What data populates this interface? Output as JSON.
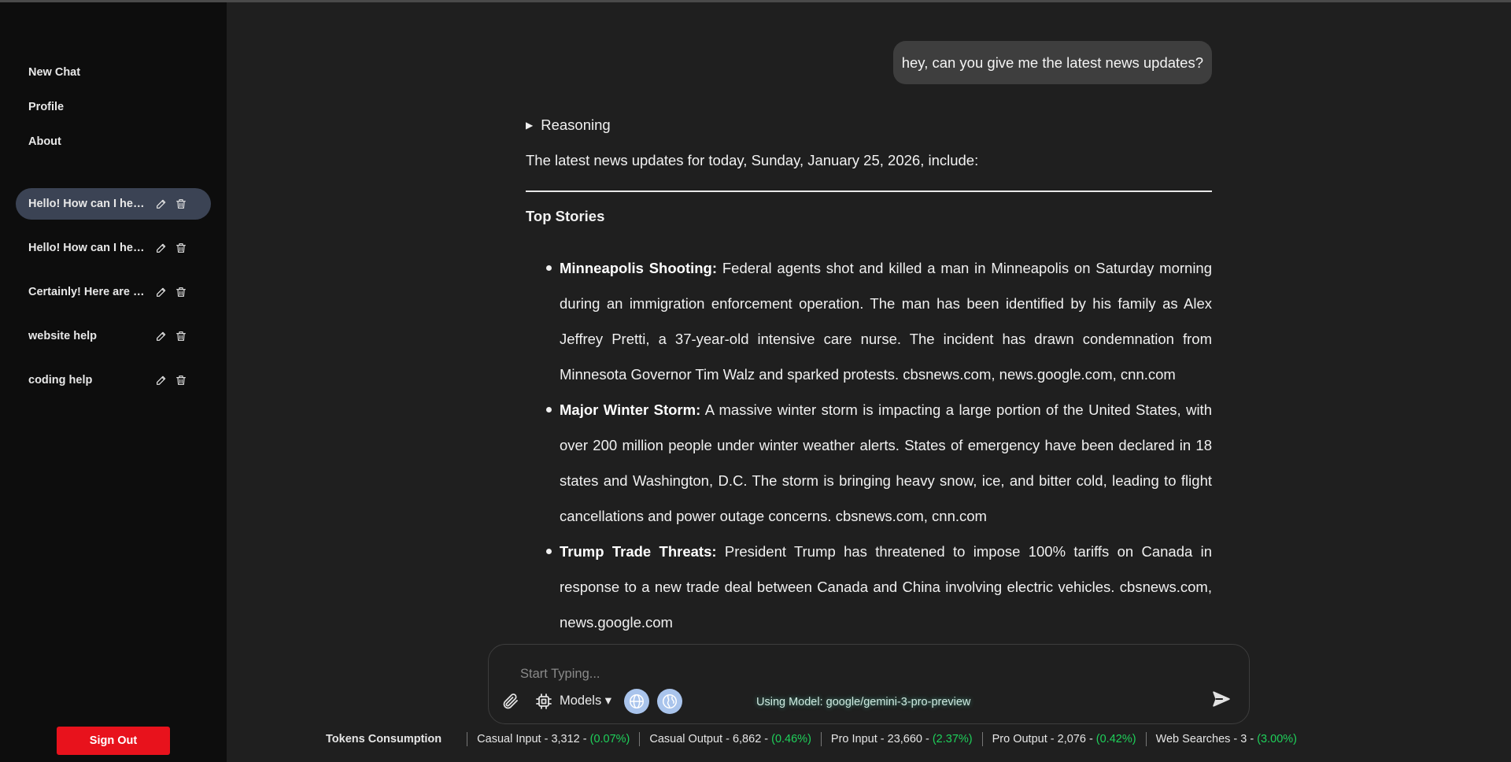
{
  "sidebar": {
    "nav": [
      "New Chat",
      "Profile",
      "About"
    ],
    "chats": [
      {
        "title": "Hello! How can I help you today?",
        "active": true
      },
      {
        "title": "Hello! How can I help you today?",
        "active": false
      },
      {
        "title": "Certainly! Here are some...",
        "active": false
      },
      {
        "title": "website help",
        "active": false
      },
      {
        "title": "coding help",
        "active": false
      }
    ],
    "sign_out": "Sign Out"
  },
  "conversation": {
    "user_message": "hey, can you give me the latest news updates?",
    "reasoning_label": "Reasoning",
    "intro": "The latest news updates for today, Sunday, January 25, 2026, include:",
    "section_title": "Top Stories",
    "items": [
      {
        "title": "Minneapolis Shooting:",
        "body": "Federal agents shot and killed a man in Minneapolis on Saturday morning during an immigration enforcement operation. The man has been identified by his family as Alex Jeffrey Pretti, a 37-year-old intensive care nurse. The incident has drawn condemnation from Minnesota Governor Tim Walz and sparked protests. cbsnews.com, news.google.com, cnn.com"
      },
      {
        "title": "Major Winter Storm:",
        "body": "A massive winter storm is impacting a large portion of the United States, with over 200 million people under winter weather alerts. States of emergency have been declared in 18 states and Washington, D.C. The storm is bringing heavy snow, ice, and bitter cold, leading to flight cancellations and power outage concerns. cbsnews.com, cnn.com"
      },
      {
        "title": "Trump Trade Threats:",
        "body": "President Trump has threatened to impose 100% tariffs on Canada in response to a new trade deal between Canada and China involving electric vehicles. cbsnews.com, news.google.com"
      }
    ]
  },
  "composer": {
    "placeholder": "Start Typing...",
    "models_label": "Models ▾",
    "using_model": "Using Model: google/gemini-3-pro-preview"
  },
  "tokens": {
    "label": "Tokens Consumption",
    "stats": [
      {
        "name": "Casual Input - 3,312 -",
        "pct": "(0.07%)"
      },
      {
        "name": "Casual Output - 6,862 -",
        "pct": "(0.46%)"
      },
      {
        "name": "Pro Input - 23,660 -",
        "pct": "(2.37%)"
      },
      {
        "name": "Pro Output - 2,076 -",
        "pct": "(0.42%)"
      },
      {
        "name": "Web Searches - 3 -",
        "pct": "(3.00%)"
      }
    ],
    "pct_color": "#1fd05a"
  },
  "colors": {
    "sidebar_bg": "#0d0d0d",
    "main_bg": "#1f1f1f",
    "active_chat": "#3b4354",
    "sign_out": "#e8121c"
  }
}
